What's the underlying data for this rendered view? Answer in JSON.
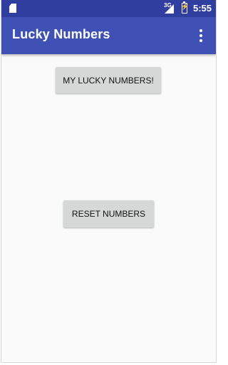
{
  "status_bar": {
    "network_label": "3G",
    "time": "5:55",
    "icons": [
      "sd-card-icon",
      "signal-icon",
      "battery-charging-icon"
    ]
  },
  "app_bar": {
    "title": "Lucky Numbers",
    "overflow_icon": "more-vert-icon"
  },
  "main": {
    "lucky_button_label": "MY LUCKY NUMBERS!",
    "reset_button_label": "RESET NUMBERS"
  },
  "colors": {
    "status_bar": "#303f9f",
    "app_bar": "#3f51b5",
    "background": "#fafafa",
    "button": "#d6d7d7"
  }
}
